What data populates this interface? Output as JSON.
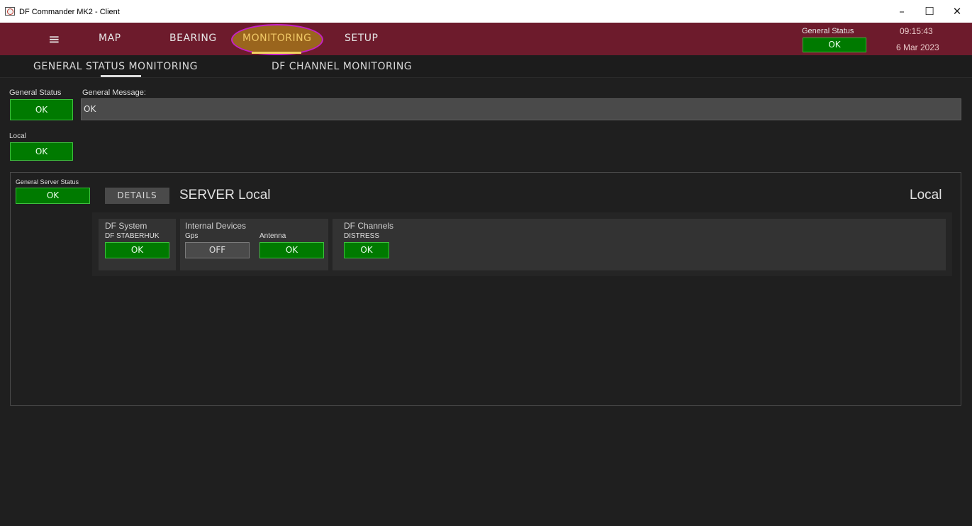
{
  "window": {
    "title": "DF Commander MK2 - Client",
    "minimize": "–",
    "maximize": "☐",
    "close": "✕"
  },
  "nav": {
    "menu_icon": "≡",
    "tabs": [
      {
        "label": "MAP"
      },
      {
        "label": "BEARING"
      },
      {
        "label": "MONITORING",
        "active": true
      },
      {
        "label": "SETUP"
      }
    ],
    "general_status_label": "General Status",
    "general_status_value": "OK",
    "time": "09:15:43",
    "date": "6 Mar 2023"
  },
  "subnav": {
    "tabs": [
      {
        "label": "GENERAL STATUS MONITORING",
        "active": true
      },
      {
        "label": "DF CHANNEL MONITORING"
      }
    ]
  },
  "general": {
    "status_label": "General Status",
    "status_value": "OK",
    "message_label": "General Message:",
    "message_value": "OK",
    "local_label": "Local",
    "local_value": "OK"
  },
  "server": {
    "status_label": "General Server Status",
    "status_value": "OK",
    "details_label": "DETAILS",
    "title": "SERVER Local",
    "location": "Local",
    "df_system": {
      "title": "DF System",
      "name": "DF STABERHUK",
      "value": "OK"
    },
    "internal_devices": {
      "title": "Internal Devices",
      "gps_label": "Gps",
      "gps_value": "OFF",
      "antenna_label": "Antenna",
      "antenna_value": "OK"
    },
    "df_channels": {
      "title": "DF Channels",
      "channel_name": "DISTRESS",
      "value": "OK"
    }
  },
  "colors": {
    "nav_bg": "#6d1b2c",
    "ok_green": "#007a00",
    "active_tab": "#f0c866",
    "highlight_ring": "#c51fc7"
  }
}
